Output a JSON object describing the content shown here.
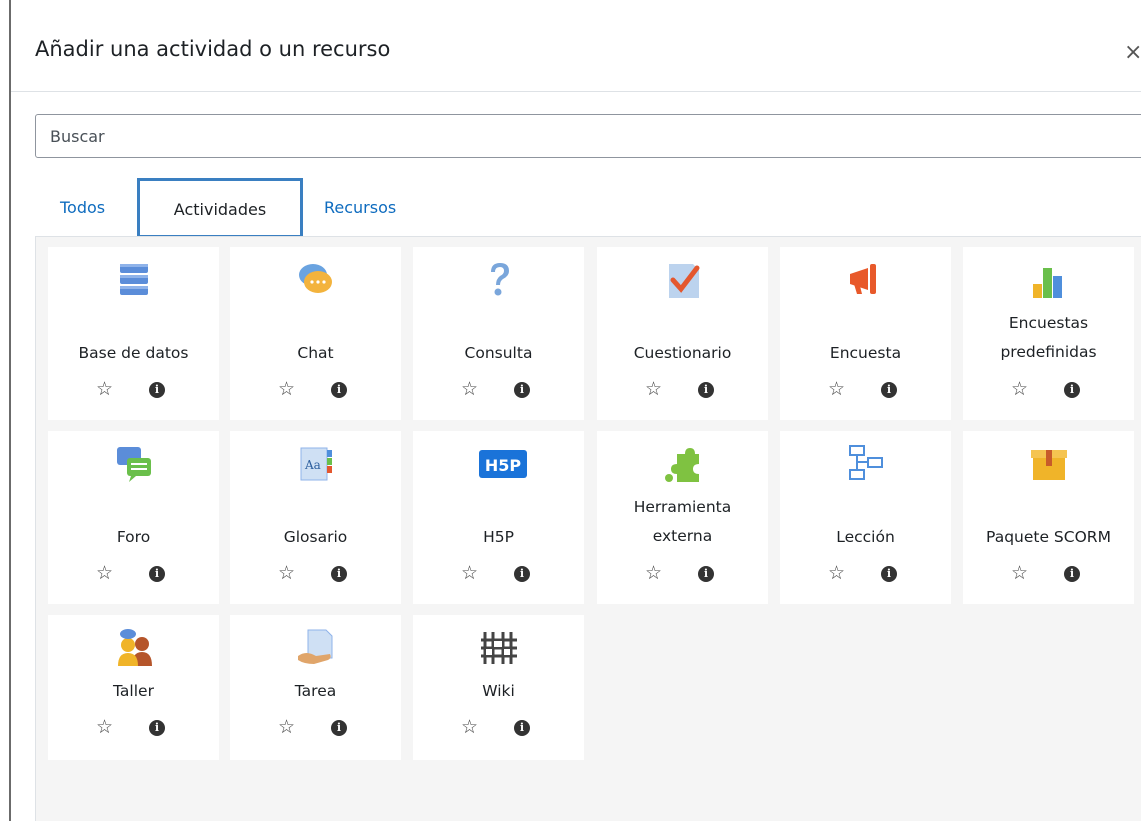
{
  "dialog": {
    "title": "Añadir una actividad o un recurso",
    "close_glyph": "×",
    "search_placeholder": "Buscar"
  },
  "tabs": [
    {
      "label": "Todos"
    },
    {
      "label": "Actividades"
    },
    {
      "label": "Recursos"
    }
  ],
  "active_tab": "Actividades",
  "actions": {
    "star_glyph": "☆",
    "info_glyph": "i"
  },
  "activities": [
    {
      "label": "Base de datos",
      "icon": "database-icon"
    },
    {
      "label": "Chat",
      "icon": "chat-icon"
    },
    {
      "label": "Consulta",
      "icon": "question-icon"
    },
    {
      "label": "Cuestionario",
      "icon": "quiz-icon"
    },
    {
      "label": "Encuesta",
      "icon": "megaphone-icon"
    },
    {
      "label": "Encuestas predefinidas",
      "icon": "bar-chart-icon"
    },
    {
      "label": "Foro",
      "icon": "forum-icon"
    },
    {
      "label": "Glosario",
      "icon": "glossary-icon"
    },
    {
      "label": "H5P",
      "icon": "h5p-icon"
    },
    {
      "label": "Herramienta externa",
      "icon": "puzzle-icon"
    },
    {
      "label": "Lección",
      "icon": "lesson-icon"
    },
    {
      "label": "Paquete SCORM",
      "icon": "package-icon"
    },
    {
      "label": "Taller",
      "icon": "workshop-icon"
    },
    {
      "label": "Tarea",
      "icon": "assignment-icon"
    },
    {
      "label": "Wiki",
      "icon": "wiki-icon"
    }
  ]
}
